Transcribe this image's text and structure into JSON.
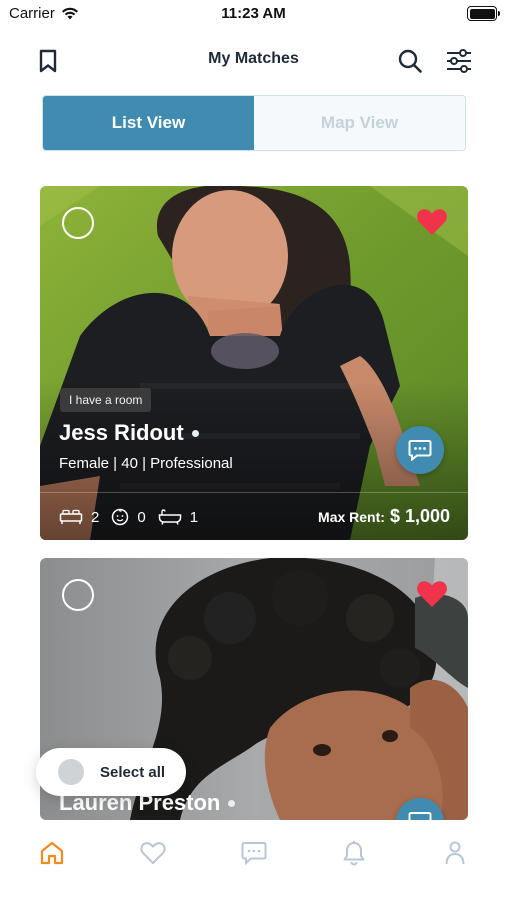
{
  "status_bar": {
    "carrier": "Carrier",
    "time": "11:23 AM"
  },
  "header": {
    "title": "My Matches"
  },
  "view_toggle": {
    "list_label": "List View",
    "map_label": "Map View",
    "active": "List View"
  },
  "colors": {
    "accent": "#3f8cb0",
    "heart": "#f0324b",
    "tab_active": "#f28c1e",
    "tab_inactive": "#b9c6d3"
  },
  "matches": [
    {
      "tag": "I have a room",
      "name": "Jess Ridout",
      "details": "Female | 40 | Professional",
      "bedrooms": "2",
      "kids": "0",
      "bathrooms": "1",
      "max_rent_label": "Max Rent:",
      "max_rent_value": "$ 1,000",
      "favorited": true
    },
    {
      "name": "Lauren Preston",
      "favorited": true
    }
  ],
  "select_all": {
    "label": "Select all"
  },
  "tab_bar": {
    "items": [
      {
        "icon": "home-icon",
        "active": true
      },
      {
        "icon": "heart-icon",
        "active": false
      },
      {
        "icon": "chat-icon",
        "active": false
      },
      {
        "icon": "bell-icon",
        "active": false
      },
      {
        "icon": "profile-icon",
        "active": false
      }
    ]
  }
}
